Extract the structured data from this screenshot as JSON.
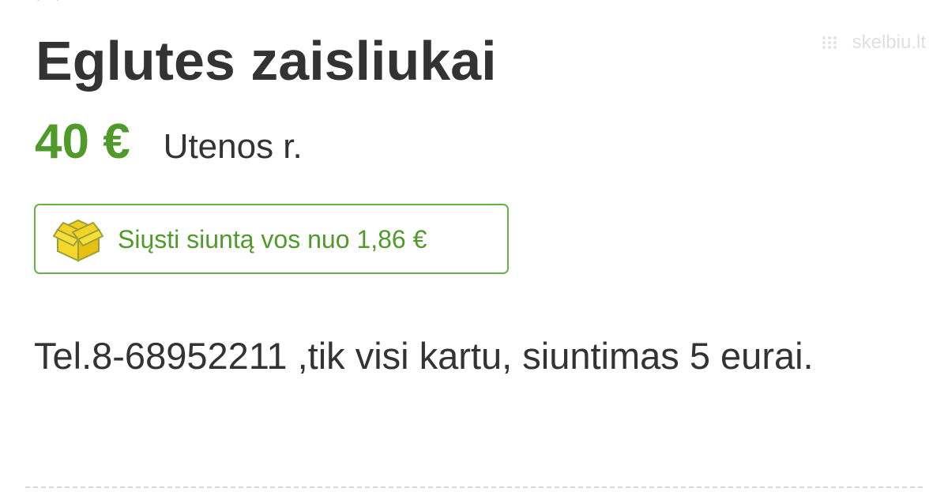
{
  "listing": {
    "title": "Eglutes zaisliukai",
    "price": "40 €",
    "location": "Utenos r.",
    "shipping_text": "Siųsti siuntą vos nuo 1,86 €",
    "description": "Tel.8-68952211 ,tik visi kartu, siuntimas 5 eurai."
  },
  "watermark": {
    "text": "skelbiu.lt"
  },
  "colors": {
    "price": "#4f9a2b",
    "shipping_border": "#67b446",
    "text": "#333333",
    "box_icon": "#f4d21f"
  },
  "icons": {
    "watermark_icon": "dots-icon",
    "shipping_icon": "box-icon"
  }
}
